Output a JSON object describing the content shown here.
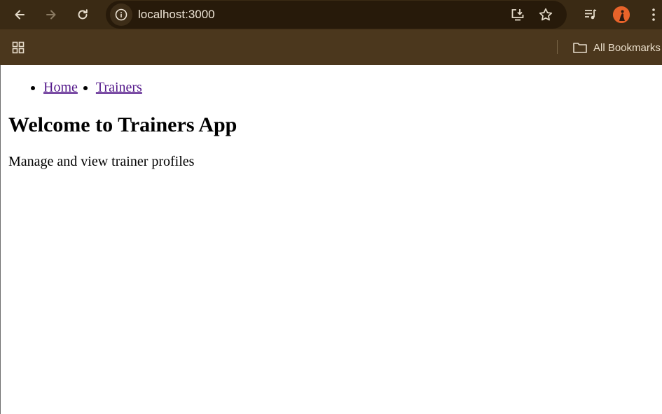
{
  "browser": {
    "url": "localhost:3000",
    "bookmarks_folder_label": "All Bookmarks",
    "icons": {
      "back": "arrow-left-icon",
      "forward": "arrow-right-icon",
      "reload": "reload-icon",
      "site_info": "info-icon",
      "install": "install-app-icon",
      "bookmark": "star-icon",
      "media": "media-control-icon",
      "menu": "kebab-menu-icon",
      "apps": "apps-grid-icon",
      "folder": "folder-icon"
    },
    "colors": {
      "toolbar": "#3a2a14",
      "omnibox": "#271a0a",
      "bookmarks_bar": "#4b371d",
      "avatar": "#e8632a"
    }
  },
  "page": {
    "nav": [
      {
        "label": "Home"
      },
      {
        "label": "Trainers"
      }
    ],
    "title": "Welcome to Trainers App",
    "subtitle": "Manage and view trainer profiles",
    "link_color": "#551a8b"
  }
}
